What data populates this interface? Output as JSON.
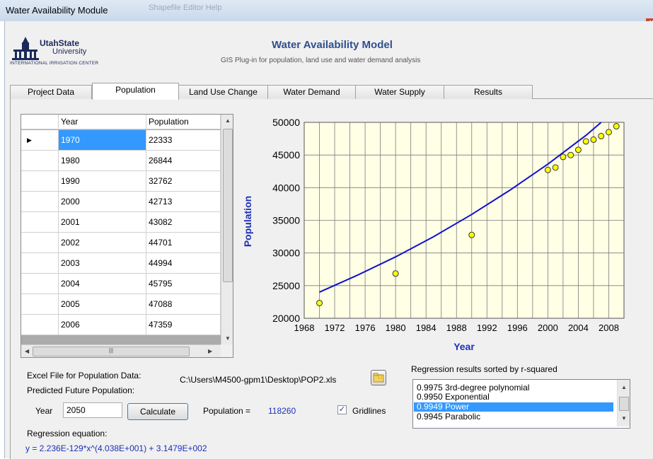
{
  "window": {
    "title": "Water Availability Module",
    "ghost_menu": "Shapefile Editor     Help"
  },
  "header": {
    "logo_line1": "UtahState",
    "logo_line2": "University",
    "logo_line3": "INTERNATIONAL IRRIGATION CENTER",
    "title": "Water Availability  Model",
    "subtitle": "GIS Plug-in for population, land use and water demand analysis"
  },
  "tabs": [
    {
      "label": "Project Data",
      "active": false
    },
    {
      "label": "Population",
      "active": true
    },
    {
      "label": "Land Use Change",
      "active": false
    },
    {
      "label": "Water Demand",
      "active": false
    },
    {
      "label": "Water Supply",
      "active": false
    },
    {
      "label": "Results",
      "active": false
    }
  ],
  "grid": {
    "columns": [
      "Year",
      "Population"
    ],
    "rows": [
      [
        "1970",
        "22333"
      ],
      [
        "1980",
        "26844"
      ],
      [
        "1990",
        "32762"
      ],
      [
        "2000",
        "42713"
      ],
      [
        "2001",
        "43082"
      ],
      [
        "2002",
        "44701"
      ],
      [
        "2003",
        "44994"
      ],
      [
        "2004",
        "45795"
      ],
      [
        "2005",
        "47088"
      ],
      [
        "2006",
        "47359"
      ]
    ],
    "selected_row": 0,
    "row_indicator": "▶"
  },
  "chart_data": {
    "type": "scatter",
    "xlabel": "Year",
    "ylabel": "Population",
    "xlim": [
      1968,
      2010
    ],
    "ylim": [
      20000,
      50000
    ],
    "x_ticks": [
      "1968",
      "1972",
      "1976",
      "1980",
      "1984",
      "1988",
      "1992",
      "1996",
      "2000",
      "2004",
      "2008"
    ],
    "y_ticks": [
      "20000",
      "25000",
      "30000",
      "35000",
      "40000",
      "45000",
      "50000"
    ],
    "grid": true,
    "points": {
      "x": [
        1970,
        1980,
        1990,
        2000,
        2001,
        2002,
        2003,
        2004,
        2005,
        2006,
        2007,
        2008,
        2009
      ],
      "y": [
        22333,
        26844,
        32762,
        42713,
        43082,
        44701,
        44994,
        45795,
        47088,
        47359,
        47900,
        48500,
        49400
      ],
      "color": "#ffff00"
    },
    "fit_line": {
      "x": [
        1970,
        1975,
        1980,
        1985,
        1990,
        1995,
        2000,
        2005,
        2007
      ],
      "y": [
        24000,
        26600,
        29400,
        32500,
        35900,
        39600,
        43600,
        48000,
        50000
      ],
      "color": "#1010cc"
    },
    "plot_bg": "#ffffe6"
  },
  "controls": {
    "excel_label": "Excel File for Population Data:",
    "excel_path": "C:\\Users\\M4500-gpm1\\Desktop\\POP2.xls",
    "predicted_label": "Predicted Future Population:",
    "year_label": "Year",
    "year_value": "2050",
    "calculate_label": "Calculate",
    "population_label": "Population =",
    "population_value": "118260",
    "gridlines_label": "Gridlines",
    "gridlines_checked": "✓",
    "regression_label": "Regression equation:",
    "regression_equation": "y = 2.236E-129*x^(4.038E+001) + 3.1479E+002",
    "results_label": "Regression results sorted by r-squared",
    "results": [
      "0.9975  3rd-degree polynomial",
      "0.9950  Exponential",
      "0.9949  Power",
      "0.9945  Parabolic"
    ],
    "results_selected": 2
  },
  "icons": {
    "browse": "folder-star-icon",
    "close": "close-icon"
  }
}
